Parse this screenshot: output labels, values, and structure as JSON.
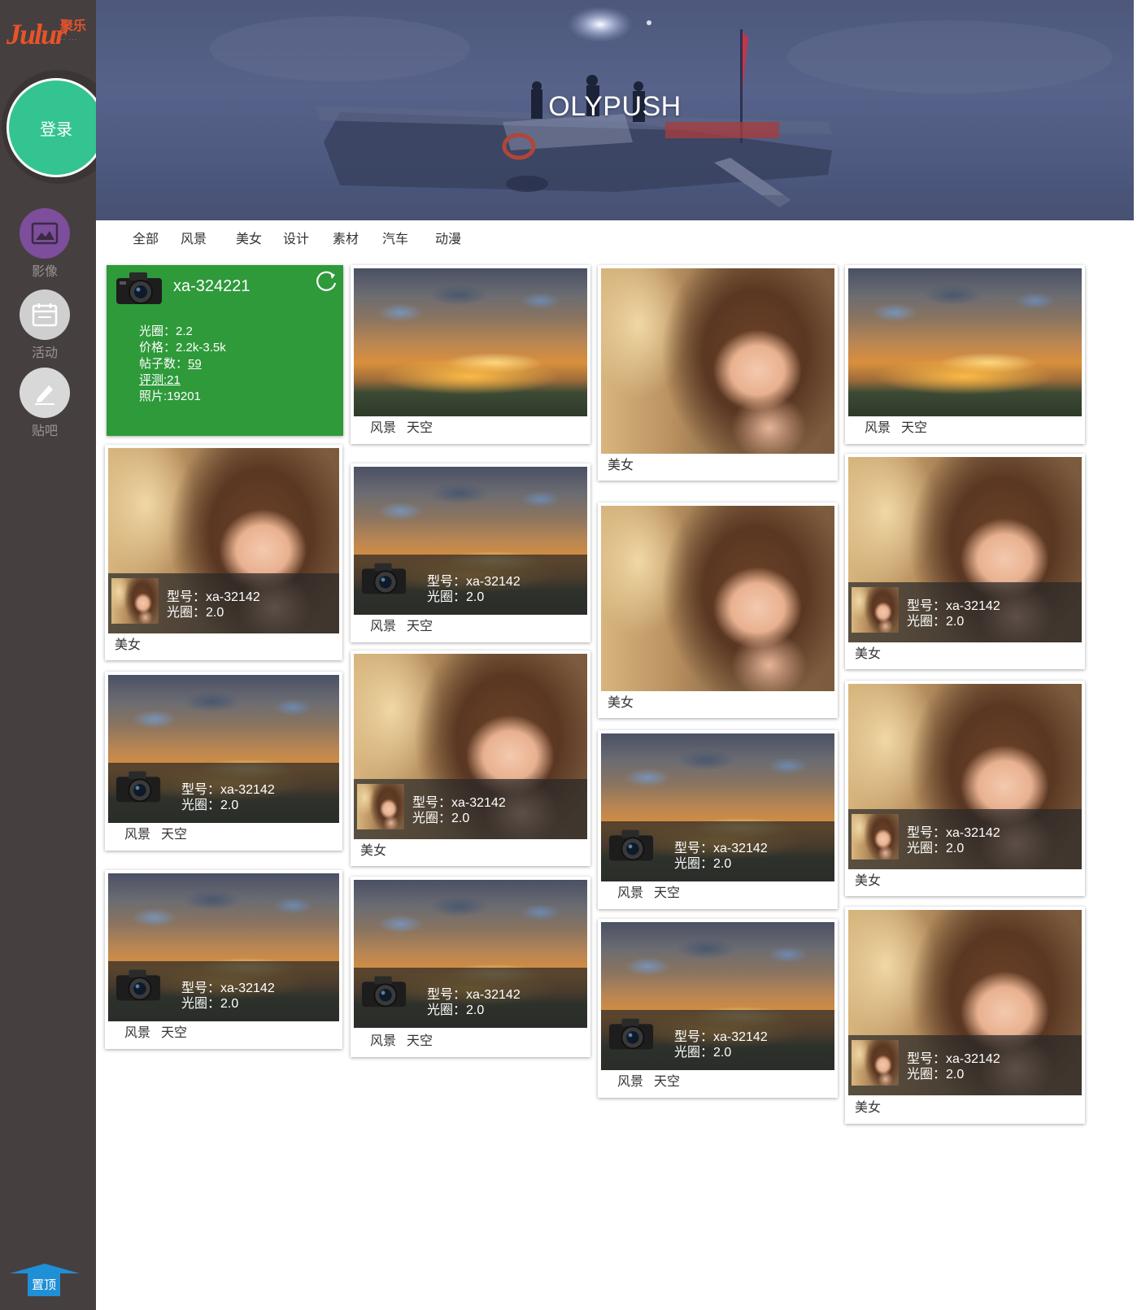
{
  "logo": {
    "latin": "Julur",
    "chinese": "聚乐",
    "dots": "·· ···"
  },
  "sidebar": {
    "login_label": "登录",
    "items": [
      {
        "label": "影像",
        "icon": "image-icon"
      },
      {
        "label": "活动",
        "icon": "calendar-icon"
      },
      {
        "label": "贴吧",
        "icon": "pencil-icon"
      }
    ],
    "top_label": "置顶"
  },
  "banner": {
    "title": "OLYPUSH"
  },
  "categories": [
    "全部",
    "风景",
    "美女",
    "设计",
    "素材",
    "汽车",
    "动漫"
  ],
  "info_card": {
    "model": "xa-324221",
    "aperture": "光圈：2.2",
    "price": "价格：2.2k-3.5k",
    "posts_label": "帖子数：",
    "posts_value": "59",
    "reviews": "评测:21",
    "photos": "照片:19201"
  },
  "overlay": {
    "model_line": "型号：xa-32142",
    "aperture_line": "光圈：2.0"
  },
  "tags": {
    "scenery": "风景",
    "sky": "天空",
    "beauty": "美女"
  },
  "colors": {
    "sidebar": "#463f3f",
    "login": "#33c491",
    "info_card": "#2e9a3a",
    "top_button": "#1f8fd6",
    "media_icon_bg": "#7d4e9c"
  }
}
